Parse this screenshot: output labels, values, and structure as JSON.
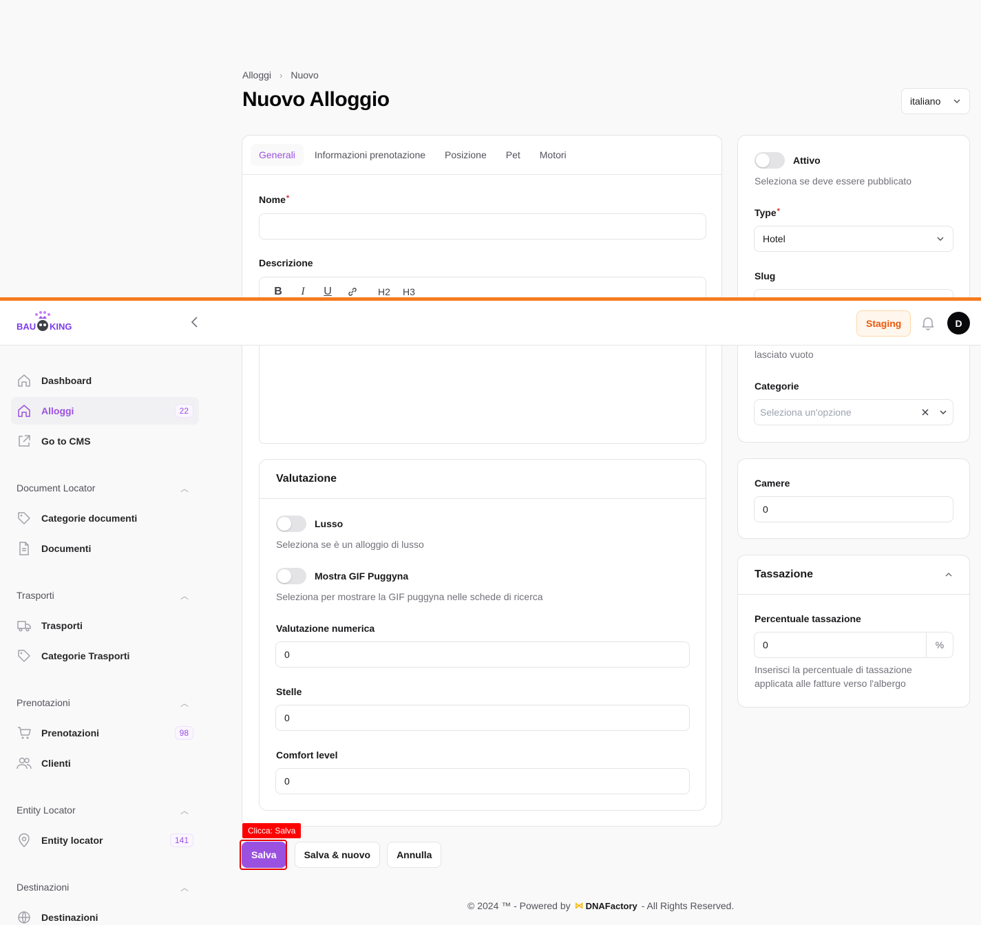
{
  "breadcrumb": {
    "parent": "Alloggi",
    "sep": "›",
    "current": "Nuovo"
  },
  "page_title": "Nuovo Alloggio",
  "language": {
    "selected": "italiano"
  },
  "tabs": [
    "Generali",
    "Informazioni prenotazione",
    "Posizione",
    "Pet",
    "Motori"
  ],
  "form": {
    "nome_label": "Nome",
    "required_mark": "*",
    "nome_value": "",
    "descrizione_label": "Descrizione",
    "editor_tools": [
      "B",
      "I",
      "U",
      "link",
      "H2",
      "H3"
    ],
    "valutazione": {
      "title": "Valutazione",
      "lusso_label": "Lusso",
      "lusso_help": "Seleziona se è un alloggio di lusso",
      "gif_label": "Mostra GIF Puggyna",
      "gif_help": "Seleziona per mostrare la GIF puggyna nelle schede di ricerca",
      "numerica_label": "Valutazione numerica",
      "numerica_value": "0",
      "stelle_label": "Stelle",
      "stelle_value": "0",
      "comfort_label": "Comfort level",
      "comfort_value": "0"
    }
  },
  "side": {
    "attivo_label": "Attivo",
    "attivo_help": "Seleziona se deve essere pubblicato",
    "type_label": "Type",
    "type_value": "Hotel",
    "slug_label": "Slug",
    "slug_help_tail": "lasciato vuoto",
    "categorie_label": "Categorie",
    "categorie_placeholder": "Seleziona un'opzione",
    "camere_label": "Camere",
    "camere_value": "0",
    "tassazione_title": "Tassazione",
    "percentuale_label": "Percentuale tassazione",
    "percentuale_value": "0",
    "percent_suffix": "%",
    "percentuale_help": "Inserisci la percentuale di tassazione applicata alle fatture verso l'albergo"
  },
  "actions": {
    "save": "Salva",
    "save_new": "Salva & nuovo",
    "cancel": "Annulla",
    "click_tag": "Clicca: Salva"
  },
  "footer": {
    "prefix": "© 2024 ™ - Powered by",
    "brand": "DNAFactory",
    "suffix": "- All Rights Reserved."
  },
  "topbar": {
    "logo_text_left": "BAU",
    "logo_text_right": "KING",
    "env_badge": "Staging",
    "avatar_initial": "D"
  },
  "sidebar": {
    "items": [
      {
        "label": "Dashboard"
      },
      {
        "label": "Alloggi",
        "badge": "22"
      },
      {
        "label": "Go to CMS"
      }
    ],
    "groups": [
      {
        "label": "Document Locator",
        "items": [
          {
            "label": "Categorie documenti"
          },
          {
            "label": "Documenti"
          }
        ]
      },
      {
        "label": "Trasporti",
        "items": [
          {
            "label": "Trasporti"
          },
          {
            "label": "Categorie Trasporti"
          }
        ]
      },
      {
        "label": "Prenotazioni",
        "items": [
          {
            "label": "Prenotazioni",
            "badge": "98"
          },
          {
            "label": "Clienti"
          }
        ]
      },
      {
        "label": "Entity Locator",
        "items": [
          {
            "label": "Entity locator",
            "badge": "141"
          }
        ]
      },
      {
        "label": "Destinazioni",
        "items": [
          {
            "label": "Destinazioni"
          }
        ]
      }
    ]
  },
  "colors": {
    "accent": "#9b51e0",
    "staging": "#ea580c",
    "top_bar": "#f47b20"
  }
}
